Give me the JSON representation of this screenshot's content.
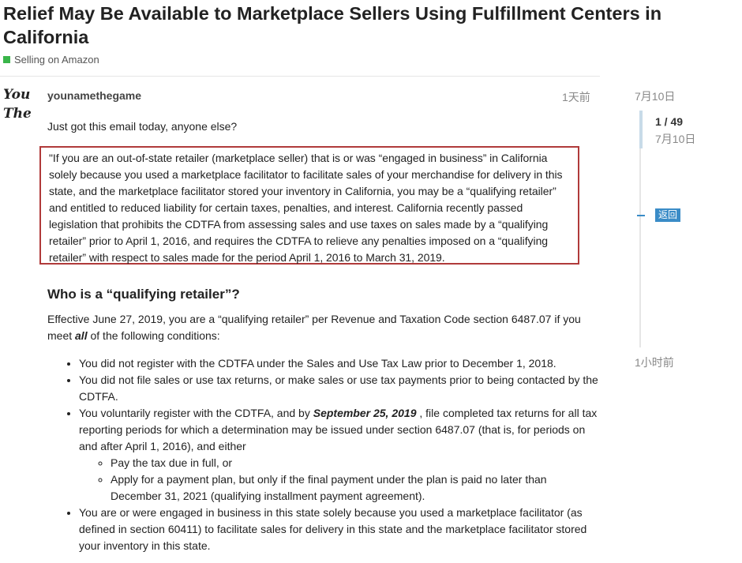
{
  "topic": {
    "title": "Relief May Be Available to Marketplace Sellers Using Fulfillment Centers in California",
    "category": "Selling on Amazon",
    "category_color": "#3ab54a"
  },
  "post": {
    "avatar_text": "You The",
    "username": "younamethegame",
    "date": "1天前",
    "intro": "Just got this email today, anyone else?",
    "quote": "\"If you are an out-of-state retailer (marketplace seller) that is or was “engaged in business” in California solely because you used a marketplace facilitator to facilitate sales of your merchandise for delivery in this state, and the marketplace facilitator stored your inventory in California, you may be a “qualifying retailer” and entitled to reduced liability for certain taxes, penalties, and interest. California recently passed legislation that prohibits the CDTFA from assessing sales and use taxes on sales made by a “qualifying retailer” prior to April 1, 2016, and requires the CDTFA to relieve any penalties imposed on a “qualifying retailer” with respect to sales made for the period April 1, 2016 to March 31, 2019.",
    "heading": "Who is a “qualifying retailer”?",
    "para_before": "Effective June 27, 2019, you are a “qualifying retailer” per Revenue and Taxation Code section 6487.07 if you meet ",
    "para_emph": "all",
    "para_after": " of the following conditions:",
    "conditions": {
      "c1": "You did not register with the CDTFA under the Sales and Use Tax Law prior to December 1, 2018.",
      "c2": "You did not file sales or use tax returns, or make sales or use tax payments prior to being contacted by the CDTFA.",
      "c3_before": "You voluntarily register with the CDTFA, and by ",
      "c3_emph": "September 25, 2019",
      "c3_after": " , file completed tax returns for all tax reporting periods for which a determination may be issued under section 6487.07 (that is, for periods on and after April 1, 2016), and either",
      "c3_sub1": "Pay the tax due in full, or",
      "c3_sub2": "Apply for a payment plan, but only if the final payment under the plan is paid no later than December 31, 2021 (qualifying installment payment agreement).",
      "c4": "You are or were engaged in business in this state solely because you used a marketplace facilitator (as defined in section 60411) to facilitate sales for delivery in this state and the marketplace facilitator stored your inventory in this state."
    },
    "quote_border_color": "#b03a3a"
  },
  "timeline": {
    "top_date": "7月10日",
    "count": "1 / 49",
    "count_date": "7月10日",
    "back_label": "返回",
    "bottom_date": "1小时前",
    "accent_color": "#3a8cc7"
  }
}
